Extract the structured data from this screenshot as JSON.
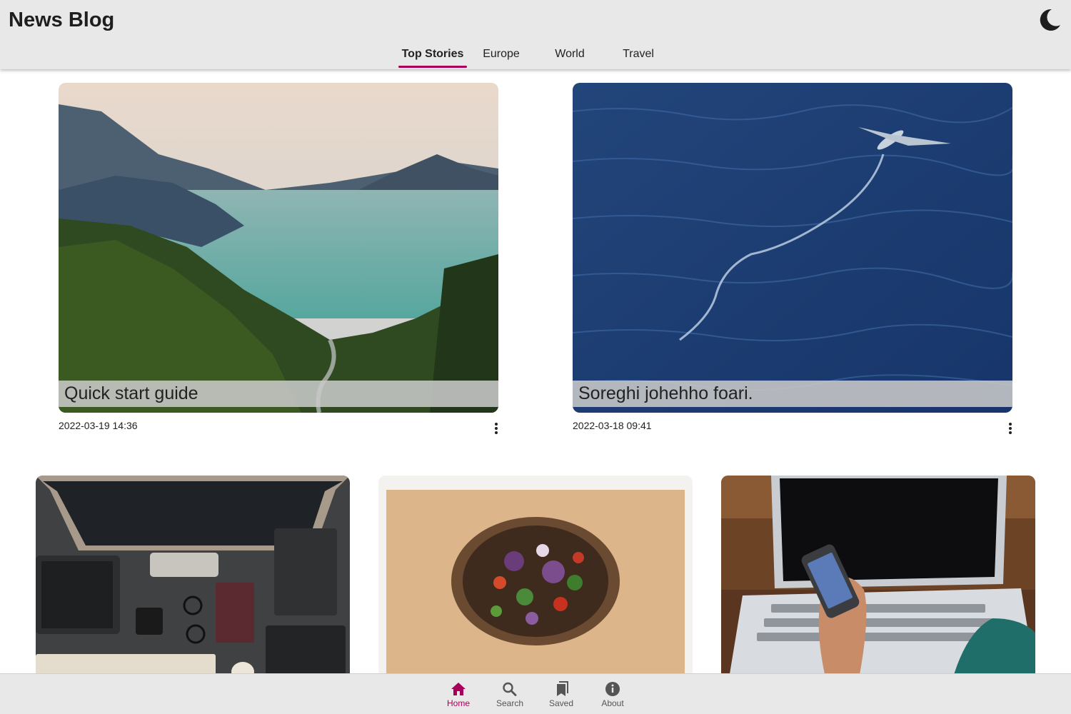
{
  "header": {
    "title": "News Blog",
    "theme_icon": "moon-icon"
  },
  "tabs": [
    {
      "label": "Top Stories",
      "active": true
    },
    {
      "label": "Europe",
      "active": false
    },
    {
      "label": "World",
      "active": false
    },
    {
      "label": "Travel",
      "active": false
    }
  ],
  "featured": [
    {
      "caption": "Quick start guide",
      "date": "2022-03-19 14:36",
      "image": "mountain-lake-photo"
    },
    {
      "caption": "Soreghi johehho foari.",
      "date": "2022-03-18 09:41",
      "image": "flying-fish-ocean-photo"
    }
  ],
  "grid": [
    {
      "image": "desk-workspace-photo"
    },
    {
      "image": "salad-bowl-photo"
    },
    {
      "image": "laptop-phone-photo"
    }
  ],
  "bottom_nav": [
    {
      "label": "Home",
      "icon": "home-icon",
      "active": true
    },
    {
      "label": "Search",
      "icon": "search-icon",
      "active": false
    },
    {
      "label": "Saved",
      "icon": "bookmarks-icon",
      "active": false
    },
    {
      "label": "About",
      "icon": "info-icon",
      "active": false
    }
  ],
  "colors": {
    "accent": "#a8005a",
    "header_bg": "#e8e8e8"
  }
}
